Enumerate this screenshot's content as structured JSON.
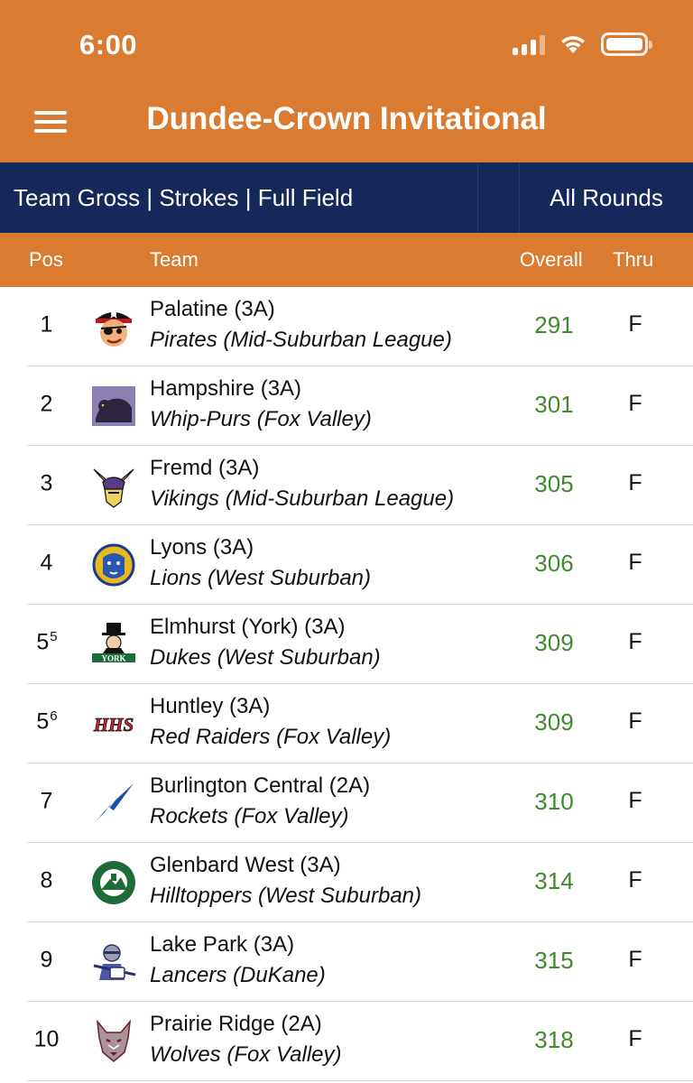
{
  "status": {
    "time": "6:00"
  },
  "header": {
    "title": "Dundee-Crown Invitational"
  },
  "filters": {
    "left": "Team Gross | Strokes | Full Field",
    "right": "All Rounds"
  },
  "columns": {
    "pos": "Pos",
    "team": "Team",
    "overall": "Overall",
    "thru": "Thru"
  },
  "colors": {
    "header": "#d97c32",
    "filterbar": "#15285a",
    "score": "#3f8a2a"
  },
  "rows": [
    {
      "pos": "1",
      "pos_sup": "",
      "name": "Palatine (3A)",
      "league": "Pirates (Mid-Suburban League)",
      "overall": "291",
      "thru": "F",
      "logo": "pirate-logo"
    },
    {
      "pos": "2",
      "pos_sup": "",
      "name": "Hampshire (3A)",
      "league": "Whip-Purs (Fox Valley)",
      "overall": "301",
      "thru": "F",
      "logo": "panther-logo"
    },
    {
      "pos": "3",
      "pos_sup": "",
      "name": "Fremd (3A)",
      "league": "Vikings (Mid-Suburban League)",
      "overall": "305",
      "thru": "F",
      "logo": "viking-logo"
    },
    {
      "pos": "4",
      "pos_sup": "",
      "name": "Lyons (3A)",
      "league": "Lions (West Suburban)",
      "overall": "306",
      "thru": "F",
      "logo": "lion-logo"
    },
    {
      "pos": "5",
      "pos_sup": "5",
      "name": "Elmhurst (York) (3A)",
      "league": "Dukes (West Suburban)",
      "overall": "309",
      "thru": "F",
      "logo": "duke-logo"
    },
    {
      "pos": "5",
      "pos_sup": "6",
      "name": "Huntley (3A)",
      "league": "Red Raiders (Fox Valley)",
      "overall": "309",
      "thru": "F",
      "logo": "hhs-logo"
    },
    {
      "pos": "7",
      "pos_sup": "",
      "name": "Burlington Central (2A)",
      "league": "Rockets (Fox Valley)",
      "overall": "310",
      "thru": "F",
      "logo": "rocket-logo"
    },
    {
      "pos": "8",
      "pos_sup": "",
      "name": "Glenbard West (3A)",
      "league": "Hilltoppers (West Suburban)",
      "overall": "314",
      "thru": "F",
      "logo": "hilltopper-logo"
    },
    {
      "pos": "9",
      "pos_sup": "",
      "name": "Lake Park (3A)",
      "league": "Lancers (DuKane)",
      "overall": "315",
      "thru": "F",
      "logo": "lancer-logo"
    },
    {
      "pos": "10",
      "pos_sup": "",
      "name": "Prairie Ridge (2A)",
      "league": "Wolves (Fox Valley)",
      "overall": "318",
      "thru": "F",
      "logo": "wolf-logo"
    }
  ]
}
